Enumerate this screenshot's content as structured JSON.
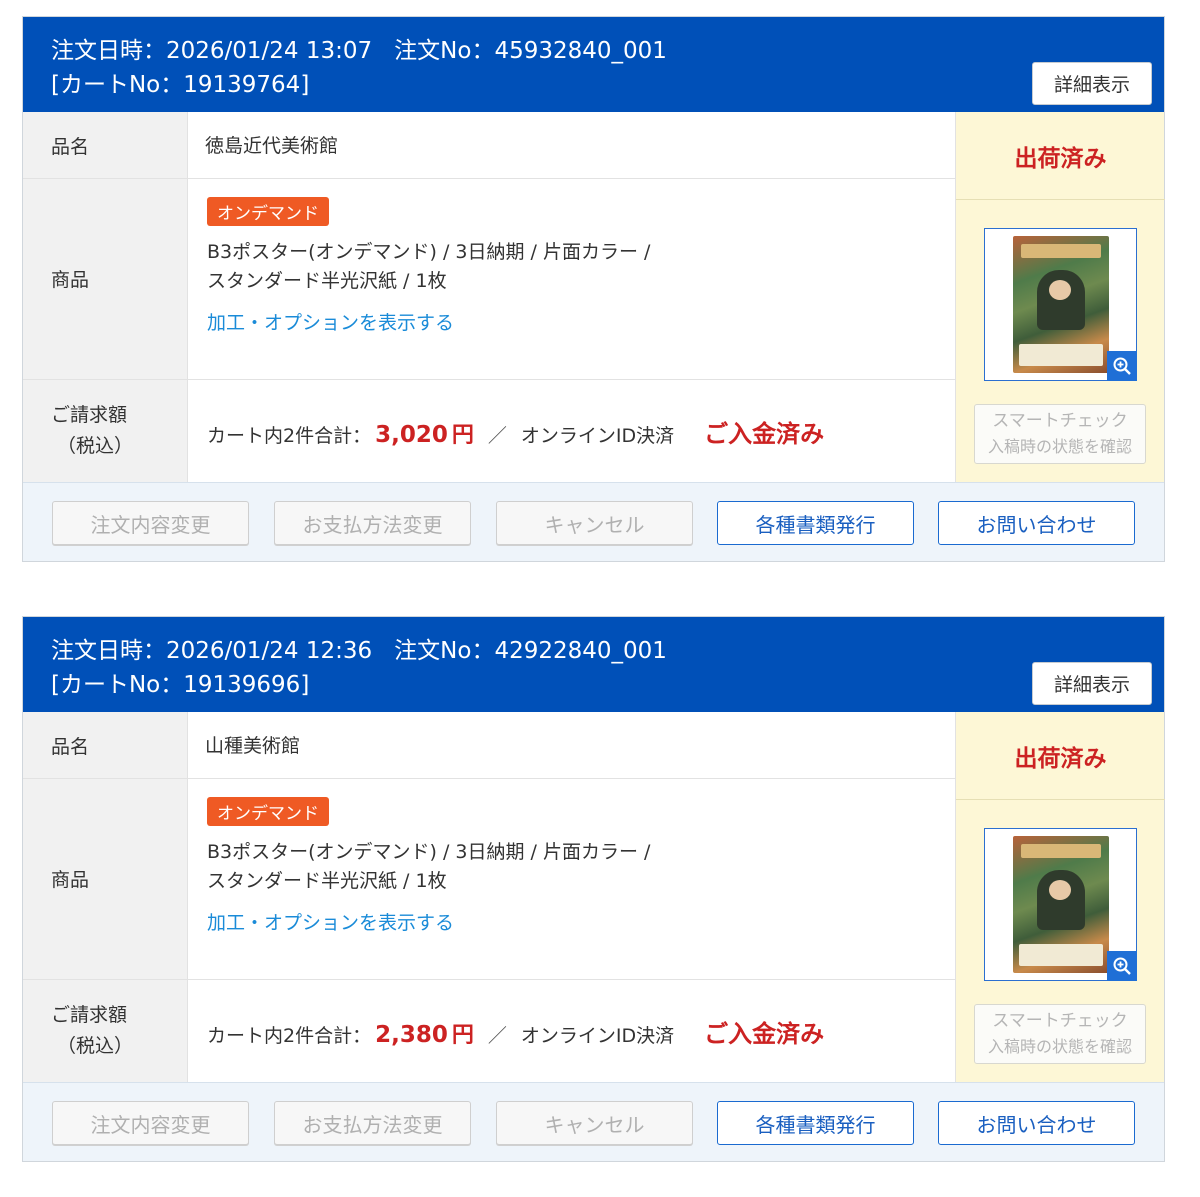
{
  "orders": [
    {
      "header_line1_date_label": "注文日時：",
      "header_line1_date": "2026/01/24 13:07",
      "header_line1_no_label": "注文No：",
      "header_line1_no": "45932840_001",
      "header_line2": "[カートNo：19139764]",
      "detail_button": "詳細表示",
      "name_label": "品名",
      "name_value": "徳島近代美術館",
      "product_label": "商品",
      "badge": "オンデマンド",
      "spec_line1": "B3ポスター(オンデマンド) / 3日納期 / 片面カラー /",
      "spec_line2": "スタンダード半光沢紙 / 1枚",
      "options_link": "加工・オプションを表示する",
      "amount_label_1": "ご請求額",
      "amount_label_2": "（税込）",
      "amount_prefix": "カート内2件合計：",
      "amount_value": "3,020",
      "amount_currency": "円",
      "amount_slash": "／",
      "payment_method": "オンラインID決済",
      "payment_status": "ご入金済み",
      "shipping_status": "出荷済み",
      "smart_check_line1": "スマートチェック",
      "smart_check_line2": "入稿時の状態を確認",
      "actions": [
        "注文内容変更",
        "お支払方法変更",
        "キャンセル",
        "各種書類発行",
        "お問い合わせ"
      ]
    },
    {
      "header_line1_date_label": "注文日時：",
      "header_line1_date": "2026/01/24 12:36",
      "header_line1_no_label": "注文No：",
      "header_line1_no": "42922840_001",
      "header_line2": "[カートNo：19139696]",
      "detail_button": "詳細表示",
      "name_label": "品名",
      "name_value": "山種美術館",
      "product_label": "商品",
      "badge": "オンデマンド",
      "spec_line1": "B3ポスター(オンデマンド) / 3日納期 / 片面カラー /",
      "spec_line2": "スタンダード半光沢紙 / 1枚",
      "options_link": "加工・オプションを表示する",
      "amount_label_1": "ご請求額",
      "amount_label_2": "（税込）",
      "amount_prefix": "カート内2件合計：",
      "amount_value": "2,380",
      "amount_currency": "円",
      "amount_slash": "／",
      "payment_method": "オンラインID決済",
      "payment_status": "ご入金済み",
      "shipping_status": "出荷済み",
      "smart_check_line1": "スマートチェック",
      "smart_check_line2": "入稿時の状態を確認",
      "actions": [
        "注文内容変更",
        "お支払方法変更",
        "キャンセル",
        "各種書類発行",
        "お問い合わせ"
      ]
    }
  ],
  "icons": {
    "zoom": "zoom-in-icon",
    "thumbnail": "poster-thumbnail"
  },
  "colors": {
    "header_bg": "#0050b8",
    "status_red": "#cc2222",
    "badge_orange": "#ef5a24",
    "link_blue": "#1a8bd8",
    "status_panel_bg": "#fdf7d6",
    "action_bar_bg": "#eef4fa"
  }
}
